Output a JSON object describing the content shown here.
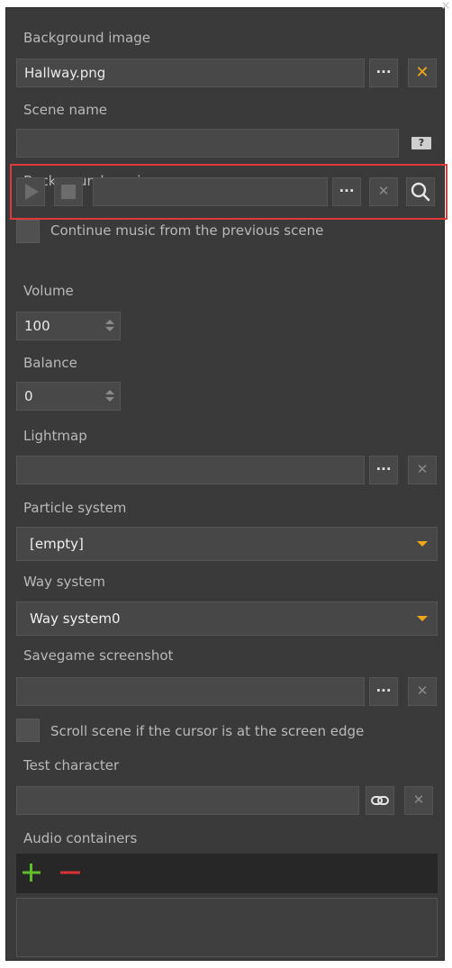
{
  "window": {
    "close_glyph": "×"
  },
  "background_image": {
    "label": "Background image",
    "value": "Hallway.png",
    "browse": "···",
    "clear": "✕"
  },
  "scene_name": {
    "label": "Scene name",
    "value": "",
    "help": "?"
  },
  "background_music": {
    "label": "Background music",
    "value": "",
    "browse": "···",
    "clear": "✕",
    "play_icon": "play-icon",
    "stop_icon": "stop-icon",
    "search_icon": "search-icon"
  },
  "continue_music": {
    "label": "Continue music from the previous scene",
    "checked": false
  },
  "volume": {
    "label": "Volume",
    "value": "100"
  },
  "balance": {
    "label": "Balance",
    "value": "0"
  },
  "lightmap": {
    "label": "Lightmap",
    "value": "",
    "browse": "···",
    "clear": "✕"
  },
  "particle_system": {
    "label": "Particle system",
    "value": "[empty]"
  },
  "way_system": {
    "label": "Way system",
    "value": "Way system0"
  },
  "savegame_screenshot": {
    "label": "Savegame screenshot",
    "value": "",
    "browse": "···",
    "clear": "✕"
  },
  "scroll_scene": {
    "label": "Scroll scene if the cursor is at the screen edge",
    "checked": false
  },
  "test_character": {
    "label": "Test character",
    "value": "",
    "link_icon": "link-icon",
    "clear": "✕"
  },
  "audio_containers": {
    "label": "Audio containers",
    "add_icon": "plus-icon",
    "remove_icon": "minus-icon"
  },
  "colors": {
    "accent": "#f0a818",
    "highlight": "#e23838",
    "add": "#5fbf2a",
    "remove": "#d93232",
    "panel": "#3a3a3a"
  }
}
